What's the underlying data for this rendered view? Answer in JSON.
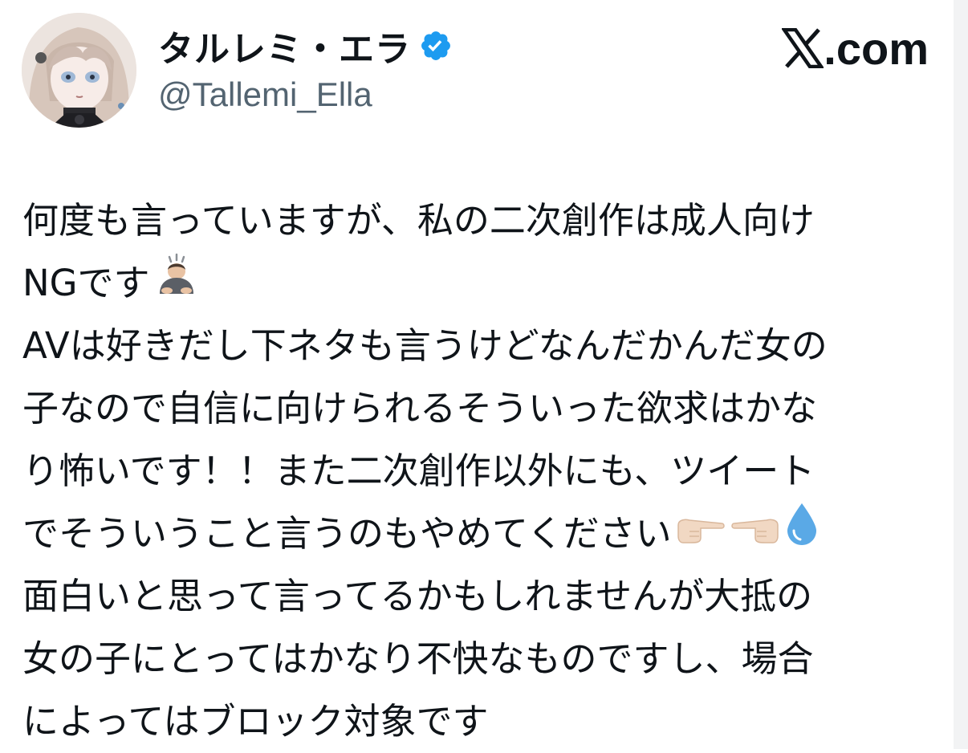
{
  "author": {
    "display_name": "タルレミ・エラ",
    "handle": "@Tallemi_Ella",
    "verified": true,
    "avatar": "anime-girl-avatar"
  },
  "brand": {
    "label": ".com",
    "logo": "x-logo-icon"
  },
  "tweet": {
    "lines": [
      "何度も言っていますが、私の二次創作は成人向け",
      "NGです",
      "AVは好きだし下ネタも言うけどなんだかんだ女の",
      "子なので自信に向けられるそういった欲求はかな",
      "り怖いです！！また二次創作以外にも、ツイート",
      "でそういうこと言うのもやめてください",
      "面白いと思って言ってるかもしれませんが大抵の",
      "女の子にとってはかなり不快なものですし、場合",
      "によってはブロック対象です"
    ],
    "emojis": {
      "line2": "bowing-person-emoji",
      "line6": [
        "pointing-right-finger-emoji",
        "pointing-left-finger-emoji",
        "droplet-emoji"
      ]
    }
  },
  "colors": {
    "text": "#0f1419",
    "secondary": "#536471",
    "verified": "#1d9bf0"
  }
}
